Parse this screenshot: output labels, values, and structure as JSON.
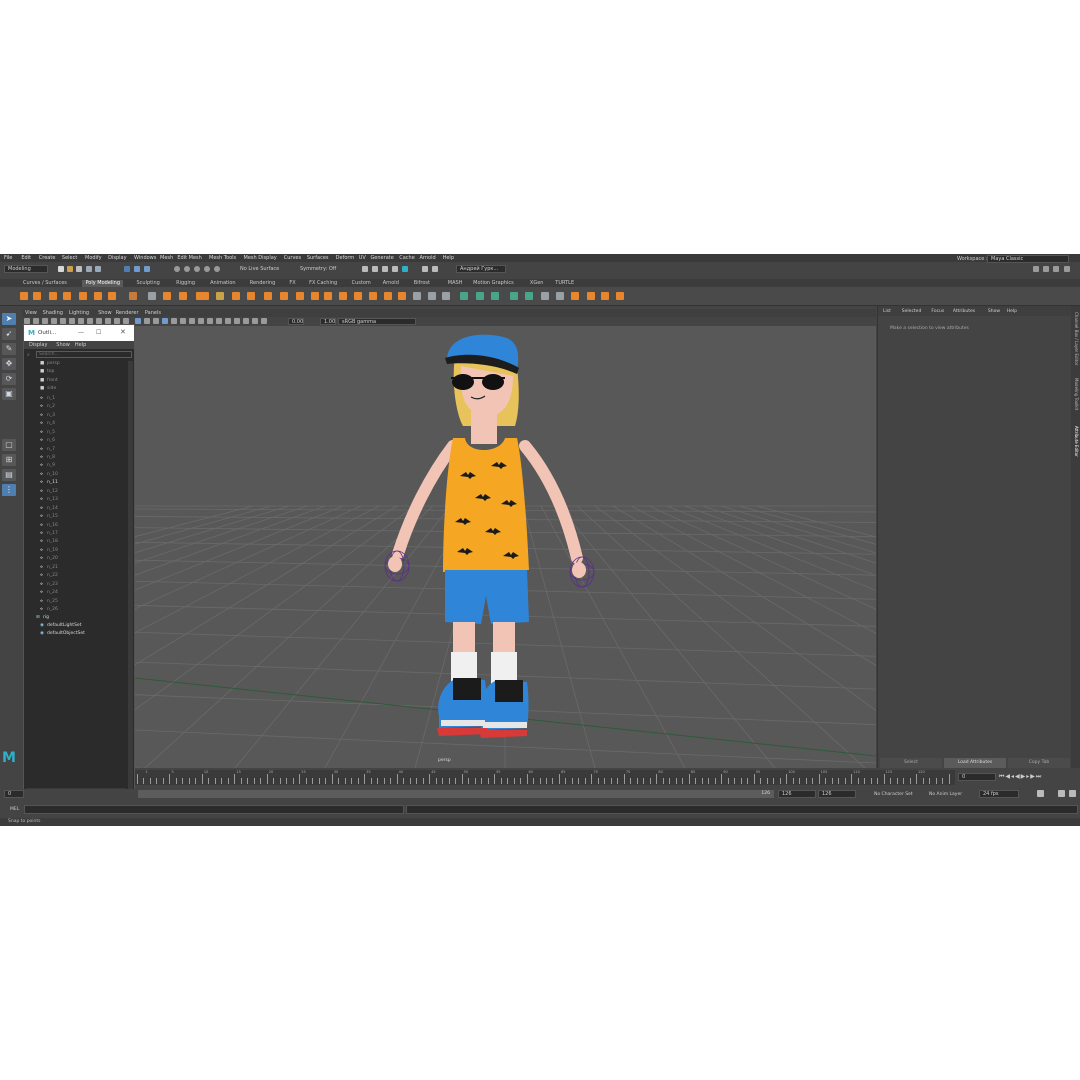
{
  "menu": [
    "File",
    "Edit",
    "Create",
    "Select",
    "Modify",
    "Display",
    "Windows",
    "Mesh",
    "Edit Mesh",
    "Mesh Tools",
    "Mesh Display",
    "Curves",
    "Surfaces",
    "Deform",
    "UV",
    "Generate",
    "Cache",
    "Arnold",
    "Help"
  ],
  "workspace": {
    "label": "Workspace :",
    "value": "Maya Classic"
  },
  "status": {
    "mode": "Modeling",
    "live_surface": "No Live Surface",
    "symmetry": "Symmetry: Off",
    "user": "Андрей Гурк..."
  },
  "shelf_tabs": [
    "Curves / Surfaces",
    "Poly Modeling",
    "Sculpting",
    "Rigging",
    "Animation",
    "Rendering",
    "FX",
    "FX Caching",
    "Custom",
    "Arnold",
    "Bifrost",
    "MASH",
    "Motion Graphics",
    "XGen",
    "TURTLE"
  ],
  "shelf_active": "Poly Modeling",
  "viewport": {
    "menu": [
      "View",
      "Shading",
      "Lighting",
      "Show",
      "Renderer",
      "Panels"
    ],
    "exposure": "0.00",
    "gamma": "1.00",
    "color_space": "sRGB gamma",
    "camera_label": "persp"
  },
  "outliner": {
    "title": "Outli...",
    "menu": [
      "Display",
      "Show",
      "Help"
    ],
    "search_placeholder": "Search...",
    "items": [
      "persp",
      "top",
      "front",
      "side",
      "n_1",
      "n_2",
      "n_3",
      "n_4",
      "n_5",
      "n_6",
      "n_7",
      "n_8",
      "n_9",
      "n_10",
      "n_11",
      "n_12",
      "n_13",
      "n_14",
      "n_15",
      "n_16",
      "n_17",
      "n_18",
      "n_19",
      "n_20",
      "n_21",
      "n_22",
      "n_23",
      "n_24",
      "n_25",
      "n_26",
      "rig",
      "defaultLightSet",
      "defaultObjectSet"
    ]
  },
  "attribute_editor": {
    "tabs": [
      "List",
      "Selected",
      "Focus",
      "Attributes",
      "Show",
      "Help"
    ],
    "message": "Make a selection to view attributes",
    "buttons": [
      "Select",
      "Load Attributes",
      "Copy Tab"
    ]
  },
  "side_tabs": [
    "Channel Box / Layer Editor",
    "Modeling Toolkit",
    "Attribute Editor"
  ],
  "timeline": {
    "ticks": [
      "1",
      "5",
      "10",
      "15",
      "20",
      "25",
      "30",
      "35",
      "40",
      "45",
      "50",
      "55",
      "60",
      "65",
      "70",
      "75",
      "80",
      "85",
      "90",
      "95",
      "100",
      "105",
      "110",
      "115",
      "120"
    ],
    "current_frame": "0"
  },
  "range": {
    "start": "0",
    "range_end": "126",
    "end": "126",
    "end2": "126",
    "character_set": "No Character Set",
    "anim_layer": "No Anim Layer",
    "fps": "24 fps"
  },
  "command": {
    "lang": "MEL"
  },
  "help_line": "Snap to points",
  "colors": {
    "panel": "#444444",
    "viewport": "#585858",
    "accent": "#4f7eb0",
    "shirt": "#f5a623",
    "shorts": "#2f86d9"
  }
}
